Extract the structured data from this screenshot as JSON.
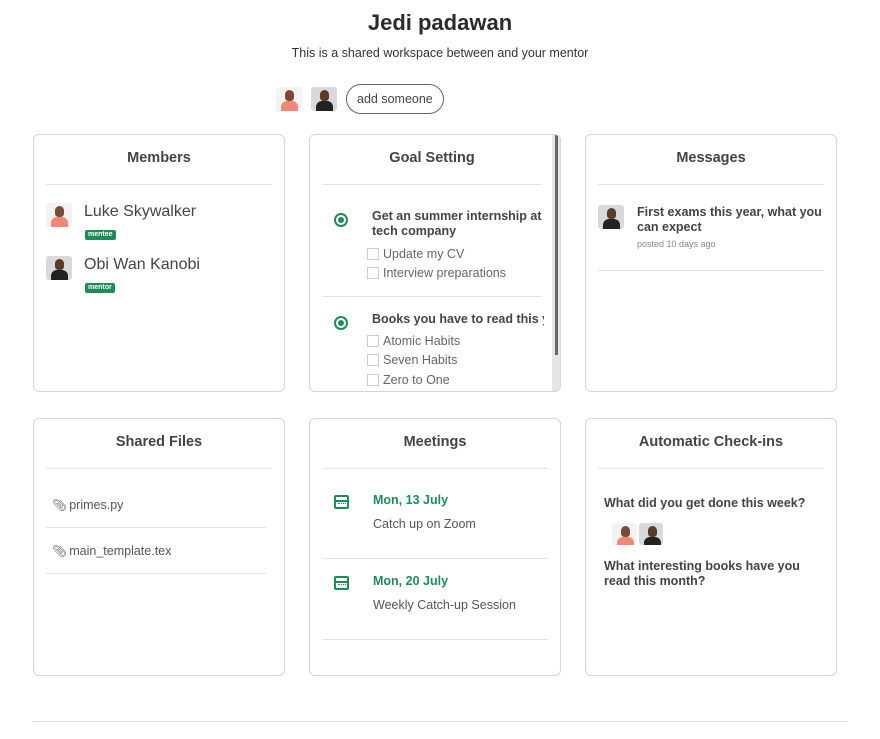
{
  "header": {
    "title": "Jedi padawan",
    "subtitle": "This is a shared workspace between and your mentor",
    "add_button": "add someone"
  },
  "members_card": {
    "title": "Members",
    "members": [
      {
        "name": "Luke Skywalker",
        "role": "mentee"
      },
      {
        "name": "Obi Wan Kanobi",
        "role": "mentor"
      }
    ]
  },
  "goals_card": {
    "title": "Goal Setting",
    "goals": [
      {
        "text": "Get an summer internship at tech company",
        "tasks": [
          "Update my CV",
          "Interview preparations"
        ]
      },
      {
        "text": "Books you have to read this y",
        "tasks": [
          "Atomic Habits",
          "Seven Habits",
          "Zero to One"
        ]
      }
    ]
  },
  "messages_card": {
    "title": "Messages",
    "messages": [
      {
        "title": "First exams this year, what you can expect",
        "meta": "posted 10 days ago"
      }
    ]
  },
  "files_card": {
    "title": "Shared Files",
    "files": [
      "primes.py",
      "main_template.tex"
    ]
  },
  "meetings_card": {
    "title": "Meetings",
    "meetings": [
      {
        "date": "Mon, 13 July",
        "description": "Catch up on Zoom"
      },
      {
        "date": "Mon, 20 July",
        "description": "Weekly Catch-up Session"
      }
    ]
  },
  "checkins_card": {
    "title": "Automatic Check-ins",
    "questions": [
      "What did you get done this week?",
      "What interesting books have you read this month?"
    ]
  },
  "colors": {
    "accent_green": "#1e8c57",
    "border": "#d6d6d6"
  }
}
